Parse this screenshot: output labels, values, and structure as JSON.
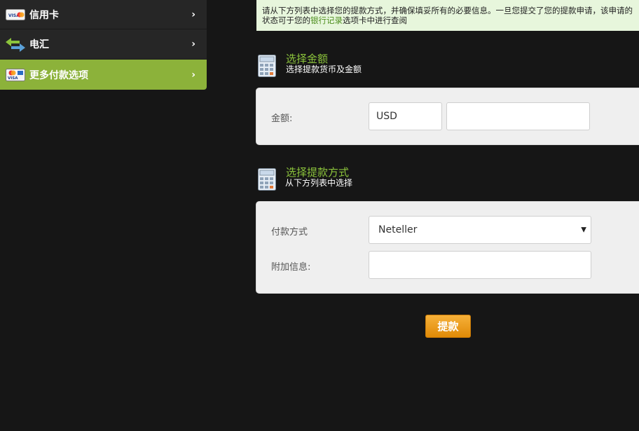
{
  "sidebar": {
    "items": [
      {
        "label": "信用卡",
        "icon": "credit-card-icon"
      },
      {
        "label": "电汇",
        "icon": "transfer-arrows-icon"
      },
      {
        "label": "更多付款选项",
        "icon": "cards-icon"
      }
    ],
    "chevron": "›"
  },
  "notice": {
    "text_before": "请从下方列表中选择您的提款方式，并确保填妥所有的必要信息。一旦您提交了您的提款申请，该申请的状态可于您的",
    "link_text": "银行记录",
    "text_after": "选项卡中进行查阅"
  },
  "amount_section": {
    "title": "选择金额",
    "subtitle": "选择提款货币及金额",
    "icon": "calculator-icon",
    "amount_label": "金额:",
    "currency_value": "USD",
    "amount_value": ""
  },
  "method_section": {
    "title": "选择提款方式",
    "subtitle": "从下方列表中选择",
    "icon": "calculator-icon",
    "method_label": "付款方式",
    "method_value": "Neteller",
    "extra_label": "附加信息:",
    "extra_value": ""
  },
  "submit": {
    "label": "提款"
  },
  "colors": {
    "accent_green": "#8cb23a",
    "title_green": "#8cc43c",
    "button_orange": "#f0a020"
  }
}
